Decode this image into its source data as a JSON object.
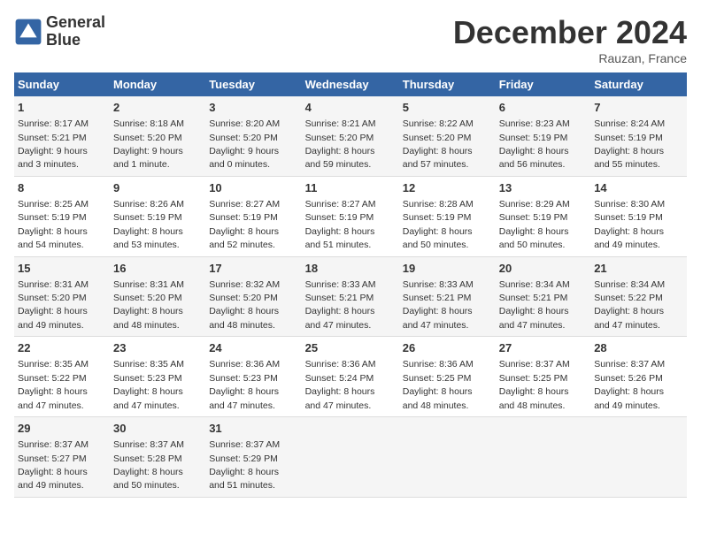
{
  "header": {
    "title": "December 2024",
    "location": "Rauzan, France",
    "logo_line1": "General",
    "logo_line2": "Blue"
  },
  "weekdays": [
    "Sunday",
    "Monday",
    "Tuesday",
    "Wednesday",
    "Thursday",
    "Friday",
    "Saturday"
  ],
  "weeks": [
    [
      {
        "day": "1",
        "info": "Sunrise: 8:17 AM\nSunset: 5:21 PM\nDaylight: 9 hours\nand 3 minutes."
      },
      {
        "day": "2",
        "info": "Sunrise: 8:18 AM\nSunset: 5:20 PM\nDaylight: 9 hours\nand 1 minute."
      },
      {
        "day": "3",
        "info": "Sunrise: 8:20 AM\nSunset: 5:20 PM\nDaylight: 9 hours\nand 0 minutes."
      },
      {
        "day": "4",
        "info": "Sunrise: 8:21 AM\nSunset: 5:20 PM\nDaylight: 8 hours\nand 59 minutes."
      },
      {
        "day": "5",
        "info": "Sunrise: 8:22 AM\nSunset: 5:20 PM\nDaylight: 8 hours\nand 57 minutes."
      },
      {
        "day": "6",
        "info": "Sunrise: 8:23 AM\nSunset: 5:19 PM\nDaylight: 8 hours\nand 56 minutes."
      },
      {
        "day": "7",
        "info": "Sunrise: 8:24 AM\nSunset: 5:19 PM\nDaylight: 8 hours\nand 55 minutes."
      }
    ],
    [
      {
        "day": "8",
        "info": "Sunrise: 8:25 AM\nSunset: 5:19 PM\nDaylight: 8 hours\nand 54 minutes."
      },
      {
        "day": "9",
        "info": "Sunrise: 8:26 AM\nSunset: 5:19 PM\nDaylight: 8 hours\nand 53 minutes."
      },
      {
        "day": "10",
        "info": "Sunrise: 8:27 AM\nSunset: 5:19 PM\nDaylight: 8 hours\nand 52 minutes."
      },
      {
        "day": "11",
        "info": "Sunrise: 8:27 AM\nSunset: 5:19 PM\nDaylight: 8 hours\nand 51 minutes."
      },
      {
        "day": "12",
        "info": "Sunrise: 8:28 AM\nSunset: 5:19 PM\nDaylight: 8 hours\nand 50 minutes."
      },
      {
        "day": "13",
        "info": "Sunrise: 8:29 AM\nSunset: 5:19 PM\nDaylight: 8 hours\nand 50 minutes."
      },
      {
        "day": "14",
        "info": "Sunrise: 8:30 AM\nSunset: 5:19 PM\nDaylight: 8 hours\nand 49 minutes."
      }
    ],
    [
      {
        "day": "15",
        "info": "Sunrise: 8:31 AM\nSunset: 5:20 PM\nDaylight: 8 hours\nand 49 minutes."
      },
      {
        "day": "16",
        "info": "Sunrise: 8:31 AM\nSunset: 5:20 PM\nDaylight: 8 hours\nand 48 minutes."
      },
      {
        "day": "17",
        "info": "Sunrise: 8:32 AM\nSunset: 5:20 PM\nDaylight: 8 hours\nand 48 minutes."
      },
      {
        "day": "18",
        "info": "Sunrise: 8:33 AM\nSunset: 5:21 PM\nDaylight: 8 hours\nand 47 minutes."
      },
      {
        "day": "19",
        "info": "Sunrise: 8:33 AM\nSunset: 5:21 PM\nDaylight: 8 hours\nand 47 minutes."
      },
      {
        "day": "20",
        "info": "Sunrise: 8:34 AM\nSunset: 5:21 PM\nDaylight: 8 hours\nand 47 minutes."
      },
      {
        "day": "21",
        "info": "Sunrise: 8:34 AM\nSunset: 5:22 PM\nDaylight: 8 hours\nand 47 minutes."
      }
    ],
    [
      {
        "day": "22",
        "info": "Sunrise: 8:35 AM\nSunset: 5:22 PM\nDaylight: 8 hours\nand 47 minutes."
      },
      {
        "day": "23",
        "info": "Sunrise: 8:35 AM\nSunset: 5:23 PM\nDaylight: 8 hours\nand 47 minutes."
      },
      {
        "day": "24",
        "info": "Sunrise: 8:36 AM\nSunset: 5:23 PM\nDaylight: 8 hours\nand 47 minutes."
      },
      {
        "day": "25",
        "info": "Sunrise: 8:36 AM\nSunset: 5:24 PM\nDaylight: 8 hours\nand 47 minutes."
      },
      {
        "day": "26",
        "info": "Sunrise: 8:36 AM\nSunset: 5:25 PM\nDaylight: 8 hours\nand 48 minutes."
      },
      {
        "day": "27",
        "info": "Sunrise: 8:37 AM\nSunset: 5:25 PM\nDaylight: 8 hours\nand 48 minutes."
      },
      {
        "day": "28",
        "info": "Sunrise: 8:37 AM\nSunset: 5:26 PM\nDaylight: 8 hours\nand 49 minutes."
      }
    ],
    [
      {
        "day": "29",
        "info": "Sunrise: 8:37 AM\nSunset: 5:27 PM\nDaylight: 8 hours\nand 49 minutes."
      },
      {
        "day": "30",
        "info": "Sunrise: 8:37 AM\nSunset: 5:28 PM\nDaylight: 8 hours\nand 50 minutes."
      },
      {
        "day": "31",
        "info": "Sunrise: 8:37 AM\nSunset: 5:29 PM\nDaylight: 8 hours\nand 51 minutes."
      },
      {
        "day": "",
        "info": ""
      },
      {
        "day": "",
        "info": ""
      },
      {
        "day": "",
        "info": ""
      },
      {
        "day": "",
        "info": ""
      }
    ]
  ]
}
